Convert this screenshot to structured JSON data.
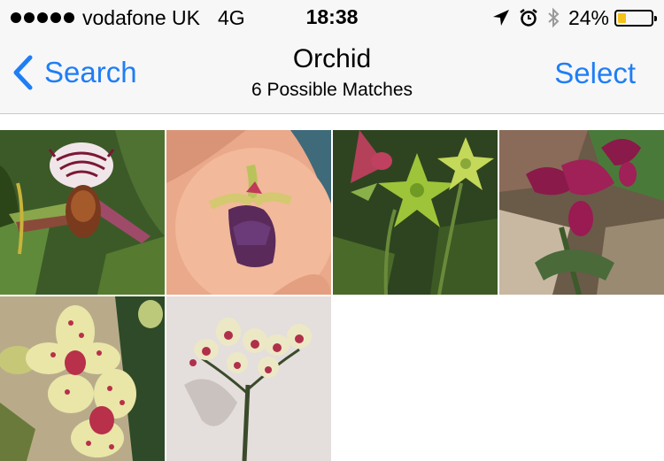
{
  "status_bar": {
    "carrier": "vodafone UK",
    "network": "4G",
    "time": "18:38",
    "battery_percent": "24%",
    "battery_level": 0.24,
    "icons": [
      "signal-dots-icon",
      "location-arrow-icon",
      "alarm-icon",
      "bluetooth-icon",
      "battery-icon"
    ]
  },
  "nav": {
    "back_label": "Search",
    "title": "Orchid",
    "subtitle": "6 Possible Matches",
    "select_label": "Select"
  },
  "colors": {
    "accent": "#1f7ef5",
    "battery_low": "#f5c21b",
    "bar_background": "#f7f7f7"
  },
  "photos": [
    {
      "name": "photo-striped-slipper-orchid"
    },
    {
      "name": "photo-tiny-orchid-on-fingertip"
    },
    {
      "name": "photo-green-star-flowers"
    },
    {
      "name": "photo-magenta-slipper-orchids"
    },
    {
      "name": "photo-spotted-phalaenopsis"
    },
    {
      "name": "photo-orchid-spray-on-white"
    }
  ]
}
